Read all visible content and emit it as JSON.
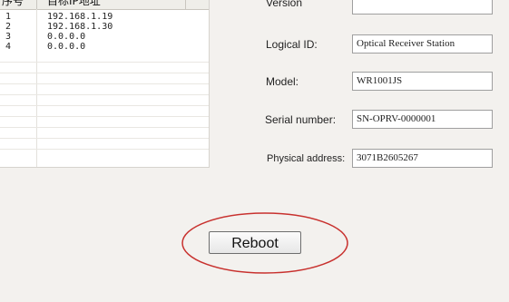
{
  "table": {
    "headers": [
      "序号",
      "目标IP地址"
    ],
    "rows": [
      {
        "no": "1",
        "ip": "192.168.1.19"
      },
      {
        "no": "2",
        "ip": "192.168.1.30"
      },
      {
        "no": "3",
        "ip": "0.0.0.0"
      },
      {
        "no": "4",
        "ip": "0.0.0.0"
      }
    ]
  },
  "form": {
    "top_label": "Version",
    "top_value": "",
    "logical_id_label": "Logical ID:",
    "logical_id_value": "Optical Receiver Station",
    "model_label": "Model:",
    "model_value": "WR1001JS",
    "serial_label": "Serial number:",
    "serial_value": "SN-OPRV-0000001",
    "physical_label": "Physical address:",
    "physical_value": "3071B2605267"
  },
  "reboot_label": "Reboot",
  "colors": {
    "highlight_ellipse": "#c8312e"
  }
}
